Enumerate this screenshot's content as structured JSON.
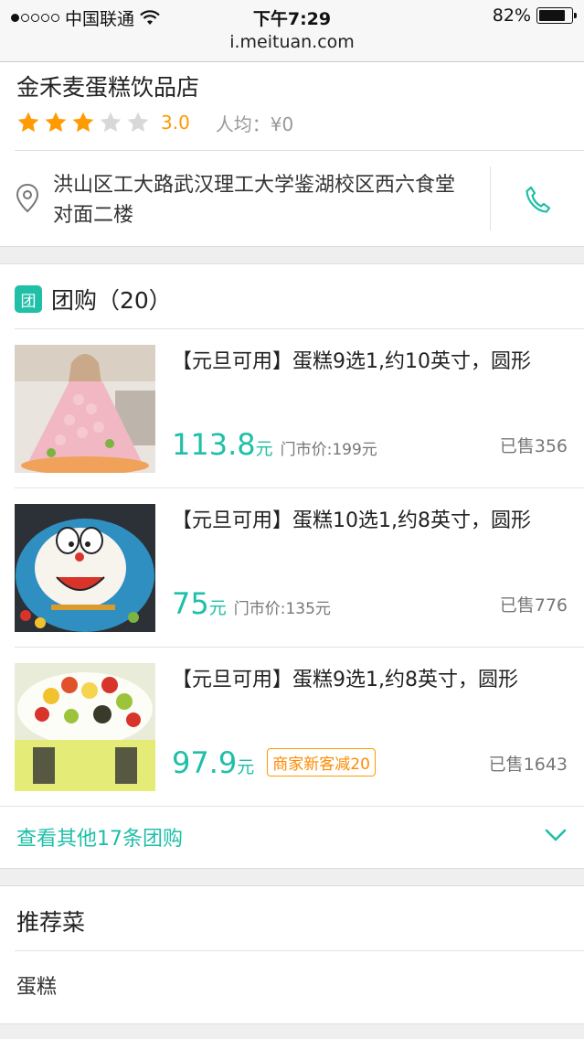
{
  "status_bar": {
    "carrier": "中国联通",
    "time": "下午7:29",
    "battery": "82%",
    "battery_level": 0.82,
    "signal_bars": 1
  },
  "browser": {
    "url": "i.meituan.com"
  },
  "shop": {
    "name": "金禾麦蛋糕饮品店",
    "rating": 3.0,
    "rating_text": "3.0",
    "stars_filled": 3,
    "stars_total": 5,
    "avg_price": "人均：¥0",
    "address": "洪山区工大路武汉理工大学鉴湖校区西六食堂对面二楼",
    "icons": {
      "location": "location-pin-icon",
      "phone": "phone-icon"
    }
  },
  "group_buy": {
    "badge": "团",
    "title": "团购（20）",
    "deals": [
      {
        "title": "【元旦可用】蛋糕9选1,约10英寸，圆形",
        "price": "113.8",
        "unit": "元",
        "market_price": "门市价:199元",
        "promo": "",
        "sold": "已售356",
        "image": "princess-dress-cake"
      },
      {
        "title": "【元旦可用】蛋糕10选1,约8英寸，圆形",
        "price": "75",
        "unit": "元",
        "market_price": "门市价:135元",
        "promo": "",
        "sold": "已售776",
        "image": "doraemon-cake"
      },
      {
        "title": "【元旦可用】蛋糕9选1,约8英寸，圆形",
        "price": "97.9",
        "unit": "元",
        "market_price": "",
        "promo": "商家新客减20",
        "sold": "已售1643",
        "image": "fruit-cake"
      }
    ],
    "more": "查看其他17条团购"
  },
  "recommended": {
    "title": "推荐菜",
    "items": [
      "蛋糕"
    ]
  },
  "colors": {
    "accent": "#1fbfa8",
    "star": "#ff9a00",
    "star_empty": "#d8d8d8",
    "promo": "#ff8a00"
  }
}
